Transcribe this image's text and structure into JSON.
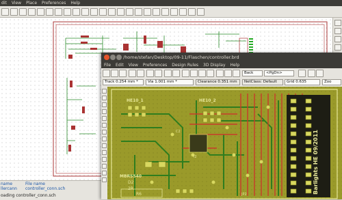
{
  "schematic": {
    "menu": [
      "dit",
      "View",
      "Place",
      "Preferences",
      "Help"
    ],
    "status": {
      "col1_header": "name",
      "col2_header": "File name",
      "col1_value": "llercann",
      "col2_value": "controller_conn.sch",
      "message": "oading controller_conn.sch"
    }
  },
  "pcb": {
    "title": "/home/stefan/Desktop/09-11/Flaschen/controller.brd",
    "menu": [
      "File",
      "Edit",
      "View",
      "Preferences",
      "Design Rules",
      "3D Display",
      "Help"
    ],
    "layer_select": "Back",
    "pgdn": "<PgDn>",
    "track": "Track 0.254 mm *",
    "via": "Via 1.001 mm *",
    "clearance": "Clearance 0.351 mm",
    "netclass": "NetClass: Default",
    "grid": "Grid 0.635",
    "zoom": "Zoo",
    "silk": {
      "he10_a": "HE10_1",
      "he10_b": "HE10_2",
      "mbrs": "MBRS540",
      "d2": "D2",
      "r": "2R",
      "r6": "R6",
      "bars": "Barlights HE 09/2011",
      "c2": "C2",
      "i2": "i2",
      "jp": "JP2"
    }
  },
  "colors": {
    "board": "#9a9a2a",
    "copper_back": "#2e7d1e",
    "copper_front": "#c83a2a",
    "pad": "#d8d860",
    "silk": "#e8e89a"
  }
}
